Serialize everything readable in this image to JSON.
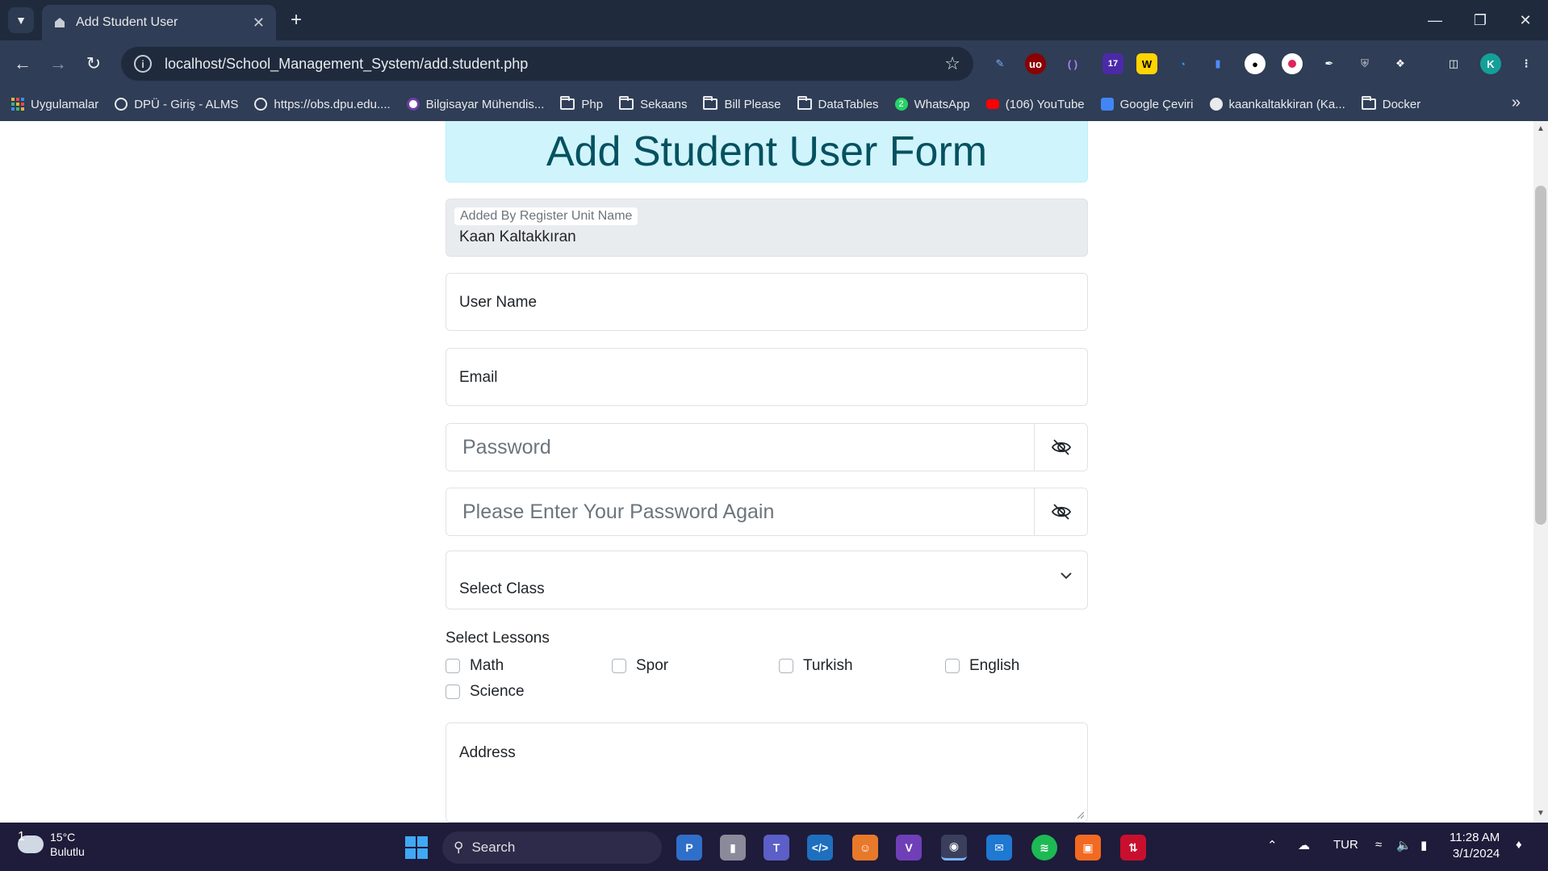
{
  "browser": {
    "tab_title": "Add Student User",
    "url": "localhost/School_Management_System/add.student.php",
    "profile_initial": "K",
    "extension_badge": "17",
    "bookmarks": [
      {
        "label": "Uygulamalar",
        "icon": "apps-grid-icon"
      },
      {
        "label": "DPÜ - Giriş - ALMS",
        "icon": "globe-icon"
      },
      {
        "label": "https://obs.dpu.edu....",
        "icon": "globe-icon"
      },
      {
        "label": "Bilgisayar Mühendis...",
        "icon": "site-icon"
      },
      {
        "label": "Php",
        "icon": "folder-icon"
      },
      {
        "label": "Sekaans",
        "icon": "folder-icon"
      },
      {
        "label": "Bill Please",
        "icon": "folder-icon"
      },
      {
        "label": "DataTables",
        "icon": "folder-icon"
      },
      {
        "label": "WhatsApp",
        "icon": "whatsapp-icon"
      },
      {
        "label": "(106) YouTube",
        "icon": "youtube-icon"
      },
      {
        "label": "Google Çeviri",
        "icon": "google-translate-icon"
      },
      {
        "label": "kaankaltakkiran (Ka...",
        "icon": "github-icon"
      },
      {
        "label": "Docker",
        "icon": "folder-icon"
      }
    ]
  },
  "form": {
    "title": "Add Student User Form",
    "added_by_label": "Added By Register Unit Name",
    "added_by_value": "Kaan Kaltakkıran",
    "username_label": "User Name",
    "email_label": "Email",
    "password_placeholder": "Password",
    "password_again_placeholder": "Please Enter Your Password Again",
    "select_class_label": "Select Class",
    "lessons_title": "Select Lessons",
    "lessons": [
      "Math",
      "Spor",
      "Turkish",
      "English",
      "Science"
    ],
    "address_label": "Address"
  },
  "taskbar": {
    "weather_temp": "15°C",
    "weather_desc": "Bulutlu",
    "weather_badge": "1",
    "search_label": "Search",
    "language": "TUR",
    "time": "11:28 AM",
    "date": "3/1/2024"
  },
  "colors": {
    "header_bg": "#cff4fc",
    "header_text": "#055160",
    "chrome_dark": "#1f2a3d",
    "chrome_toolbar": "#2f3d56"
  }
}
